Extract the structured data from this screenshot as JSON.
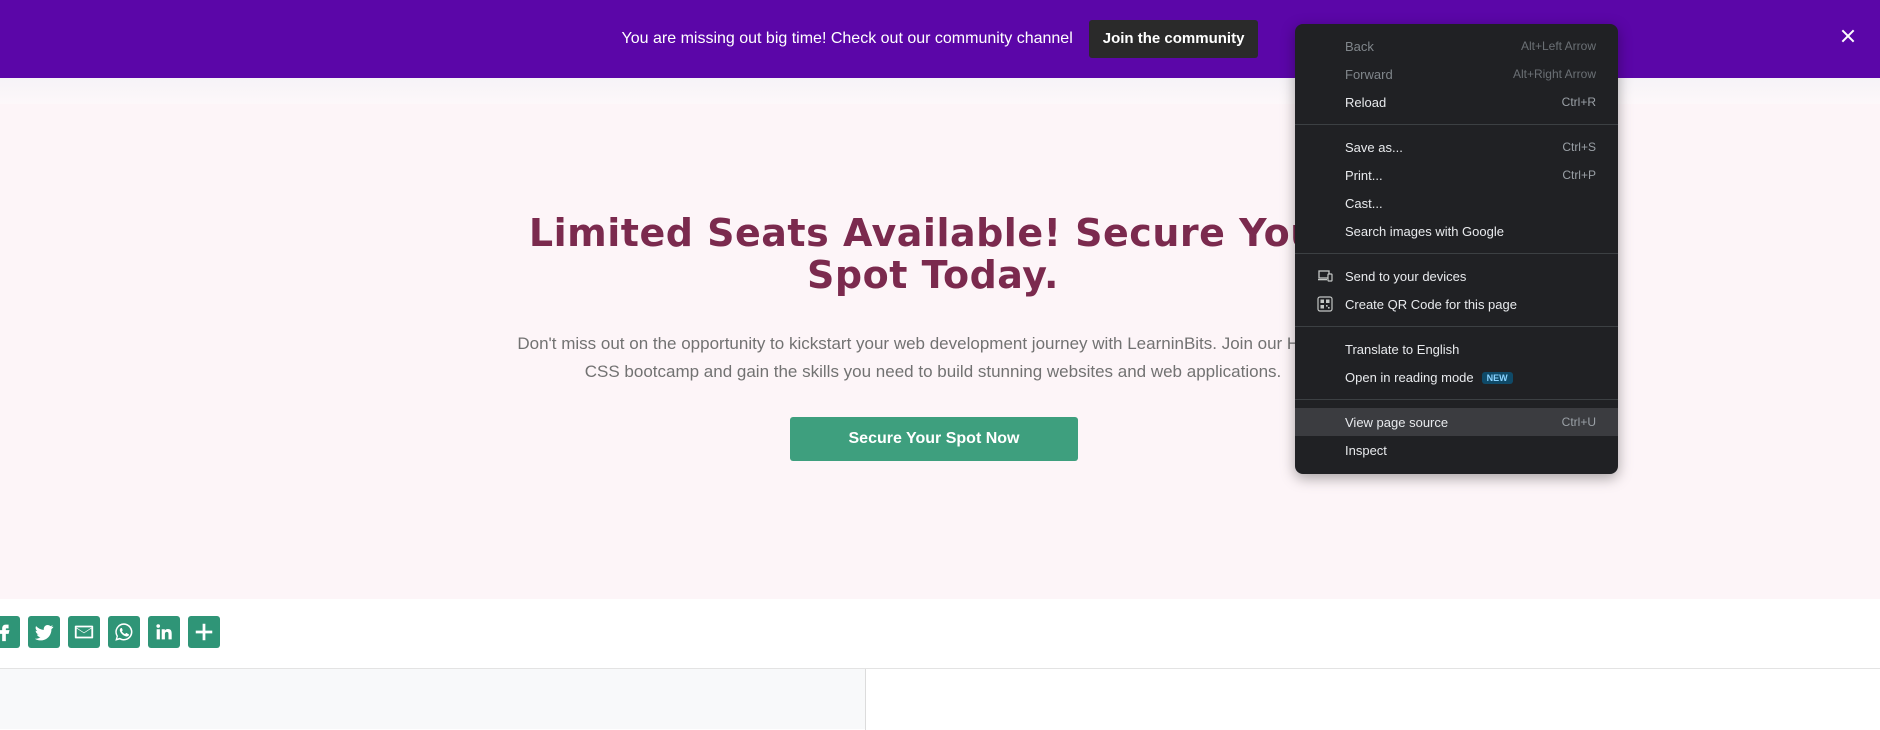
{
  "banner": {
    "text": "You are missing out big time! Check out our community channel",
    "button_label": "Join the community",
    "bg_color": "#5b06a8"
  },
  "hero": {
    "title": "Limited Seats Available! Secure Your Spot Today.",
    "description_line1": "Don't miss out on the opportunity to kickstart your web development journey with LearninBits. Join our HTML &",
    "description_line2": "CSS bootcamp and gain the skills you need to build stunning websites and web applications.",
    "button_label": "Secure Your Spot Now",
    "title_color": "#7b2a4e",
    "button_color": "#3e9f7e"
  },
  "share": {
    "icons": [
      "facebook-icon",
      "twitter-icon",
      "email-icon",
      "whatsapp-icon",
      "linkedin-icon",
      "plus-icon"
    ],
    "color": "#2f9577"
  },
  "context_menu": {
    "groups": [
      [
        {
          "label": "Back",
          "shortcut": "Alt+Left Arrow",
          "disabled": true
        },
        {
          "label": "Forward",
          "shortcut": "Alt+Right Arrow",
          "disabled": true
        },
        {
          "label": "Reload",
          "shortcut": "Ctrl+R",
          "disabled": false
        }
      ],
      [
        {
          "label": "Save as...",
          "shortcut": "Ctrl+S"
        },
        {
          "label": "Print...",
          "shortcut": "Ctrl+P"
        },
        {
          "label": "Cast...",
          "shortcut": ""
        },
        {
          "label": "Search images with Google",
          "shortcut": ""
        }
      ],
      [
        {
          "label": "Send to your devices",
          "icon": "devices-icon"
        },
        {
          "label": "Create QR Code for this page",
          "icon": "qr-code-icon"
        }
      ],
      [
        {
          "label": "Translate to English"
        },
        {
          "label": "Open in reading mode",
          "badge": "NEW"
        }
      ],
      [
        {
          "label": "View page source",
          "shortcut": "Ctrl+U",
          "highlighted": true
        },
        {
          "label": "Inspect",
          "shortcut": ""
        }
      ]
    ]
  }
}
